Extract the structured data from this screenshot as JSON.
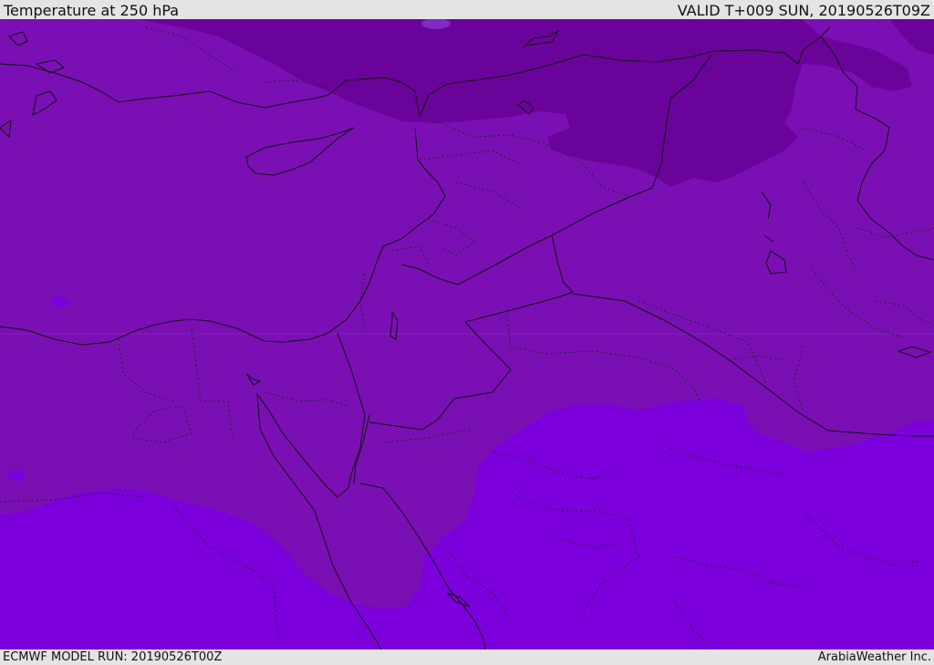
{
  "header": {
    "title": "Temperature at 250 hPa",
    "valid": "VALID T+009 SUN, 20190526T09Z"
  },
  "footer": {
    "model_run": "ECMWF MODEL RUN: 20190526T00Z",
    "credit": "ArabiaWeather Inc."
  },
  "colors": {
    "band_cold": "#6a0399",
    "band_mid": "#7a10b4",
    "band_warm": "#7c00dc",
    "border": "#111111"
  }
}
